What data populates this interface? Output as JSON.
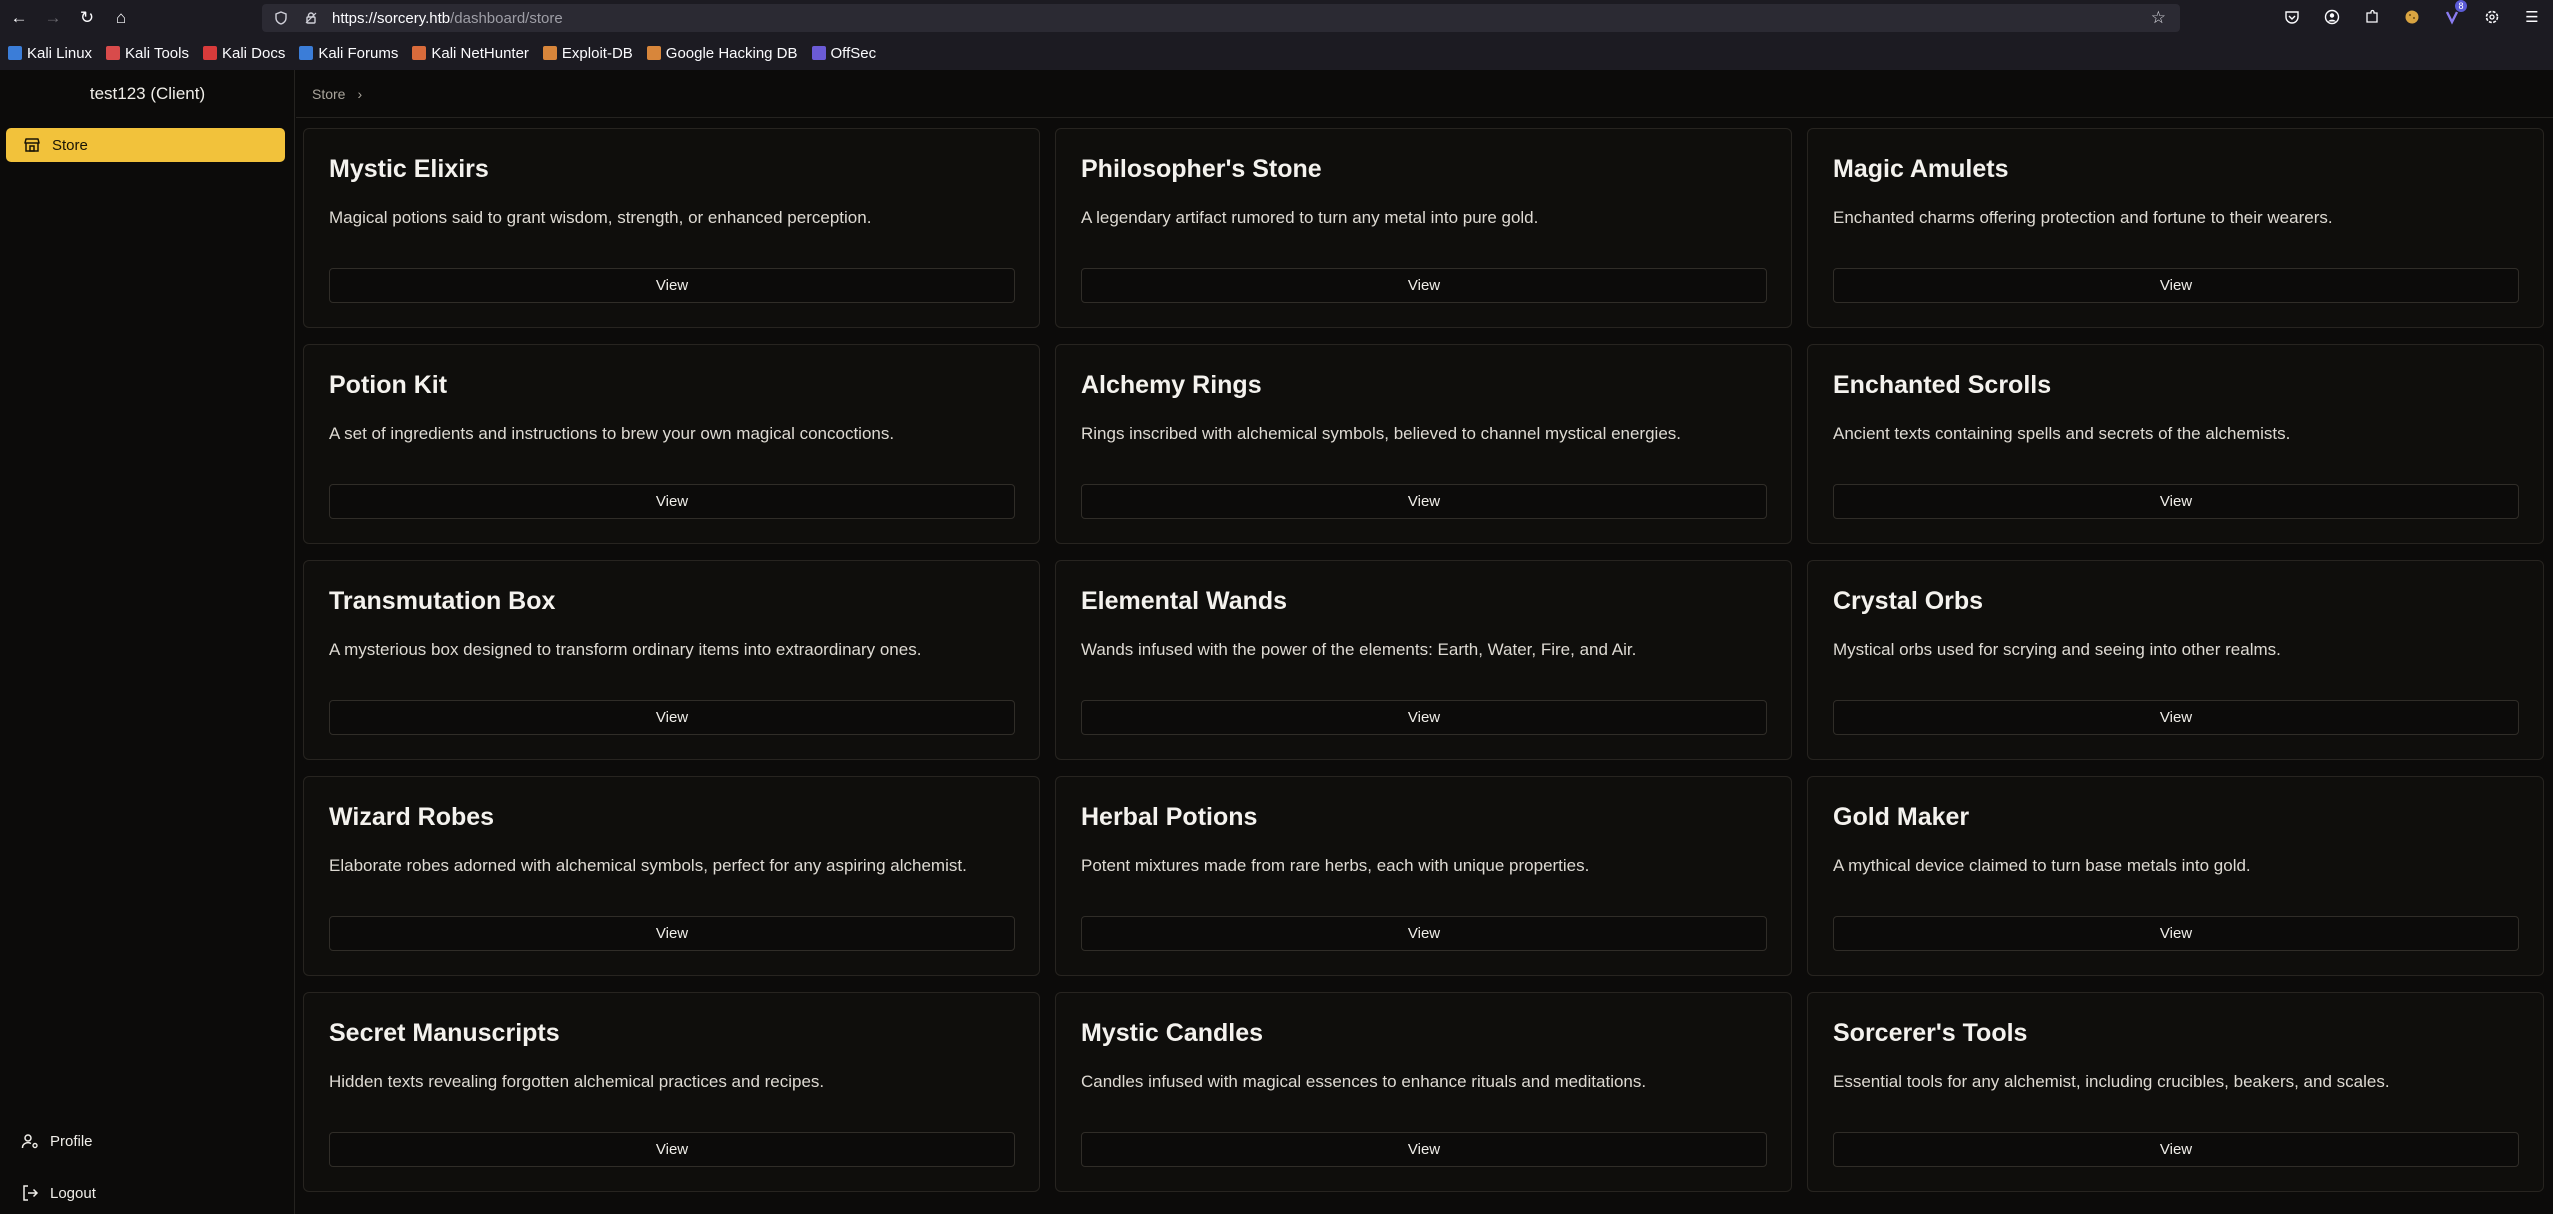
{
  "browser": {
    "url_host": "https://sorcery.htb",
    "url_path": "/dashboard/store",
    "bookmarks": [
      {
        "label": "Kali Linux",
        "color": "#3b7dd8"
      },
      {
        "label": "Kali Tools",
        "color": "#d84b4b"
      },
      {
        "label": "Kali Docs",
        "color": "#d83b3b"
      },
      {
        "label": "Kali Forums",
        "color": "#3b7dd8"
      },
      {
        "label": "Kali NetHunter",
        "color": "#d86b3b"
      },
      {
        "label": "Exploit-DB",
        "color": "#d8863b"
      },
      {
        "label": "Google Hacking DB",
        "color": "#d8863b"
      },
      {
        "label": "OffSec",
        "color": "#6b5bd6"
      }
    ],
    "extension_badge": "8"
  },
  "sidebar": {
    "title": "test123 (Client)",
    "active_item": "Store",
    "profile_label": "Profile",
    "logout_label": "Logout"
  },
  "breadcrumb": {
    "current": "Store"
  },
  "products": [
    {
      "title": "Mystic Elixirs",
      "desc": "Magical potions said to grant wisdom, strength, or enhanced perception.",
      "button": "View"
    },
    {
      "title": "Philosopher's Stone",
      "desc": "A legendary artifact rumored to turn any metal into pure gold.",
      "button": "View"
    },
    {
      "title": "Magic Amulets",
      "desc": "Enchanted charms offering protection and fortune to their wearers.",
      "button": "View"
    },
    {
      "title": "Potion Kit",
      "desc": "A set of ingredients and instructions to brew your own magical concoctions.",
      "button": "View"
    },
    {
      "title": "Alchemy Rings",
      "desc": "Rings inscribed with alchemical symbols, believed to channel mystical energies.",
      "button": "View"
    },
    {
      "title": "Enchanted Scrolls",
      "desc": "Ancient texts containing spells and secrets of the alchemists.",
      "button": "View"
    },
    {
      "title": "Transmutation Box",
      "desc": "A mysterious box designed to transform ordinary items into extraordinary ones.",
      "button": "View"
    },
    {
      "title": "Elemental Wands",
      "desc": "Wands infused with the power of the elements: Earth, Water, Fire, and Air.",
      "button": "View"
    },
    {
      "title": "Crystal Orbs",
      "desc": "Mystical orbs used for scrying and seeing into other realms.",
      "button": "View"
    },
    {
      "title": "Wizard Robes",
      "desc": "Elaborate robes adorned with alchemical symbols, perfect for any aspiring alchemist.",
      "button": "View"
    },
    {
      "title": "Herbal Potions",
      "desc": "Potent mixtures made from rare herbs, each with unique properties.",
      "button": "View"
    },
    {
      "title": "Gold Maker",
      "desc": "A mythical device claimed to turn base metals into gold.",
      "button": "View"
    },
    {
      "title": "Secret Manuscripts",
      "desc": "Hidden texts revealing forgotten alchemical practices and recipes.",
      "button": "View"
    },
    {
      "title": "Mystic Candles",
      "desc": "Candles infused with magical essences to enhance rituals and meditations.",
      "button": "View"
    },
    {
      "title": "Sorcerer's Tools",
      "desc": "Essential tools for any alchemist, including crucibles, beakers, and scales.",
      "button": "View"
    }
  ],
  "colors": {
    "accent": "#f2c23b",
    "background": "#0c0b0a"
  }
}
